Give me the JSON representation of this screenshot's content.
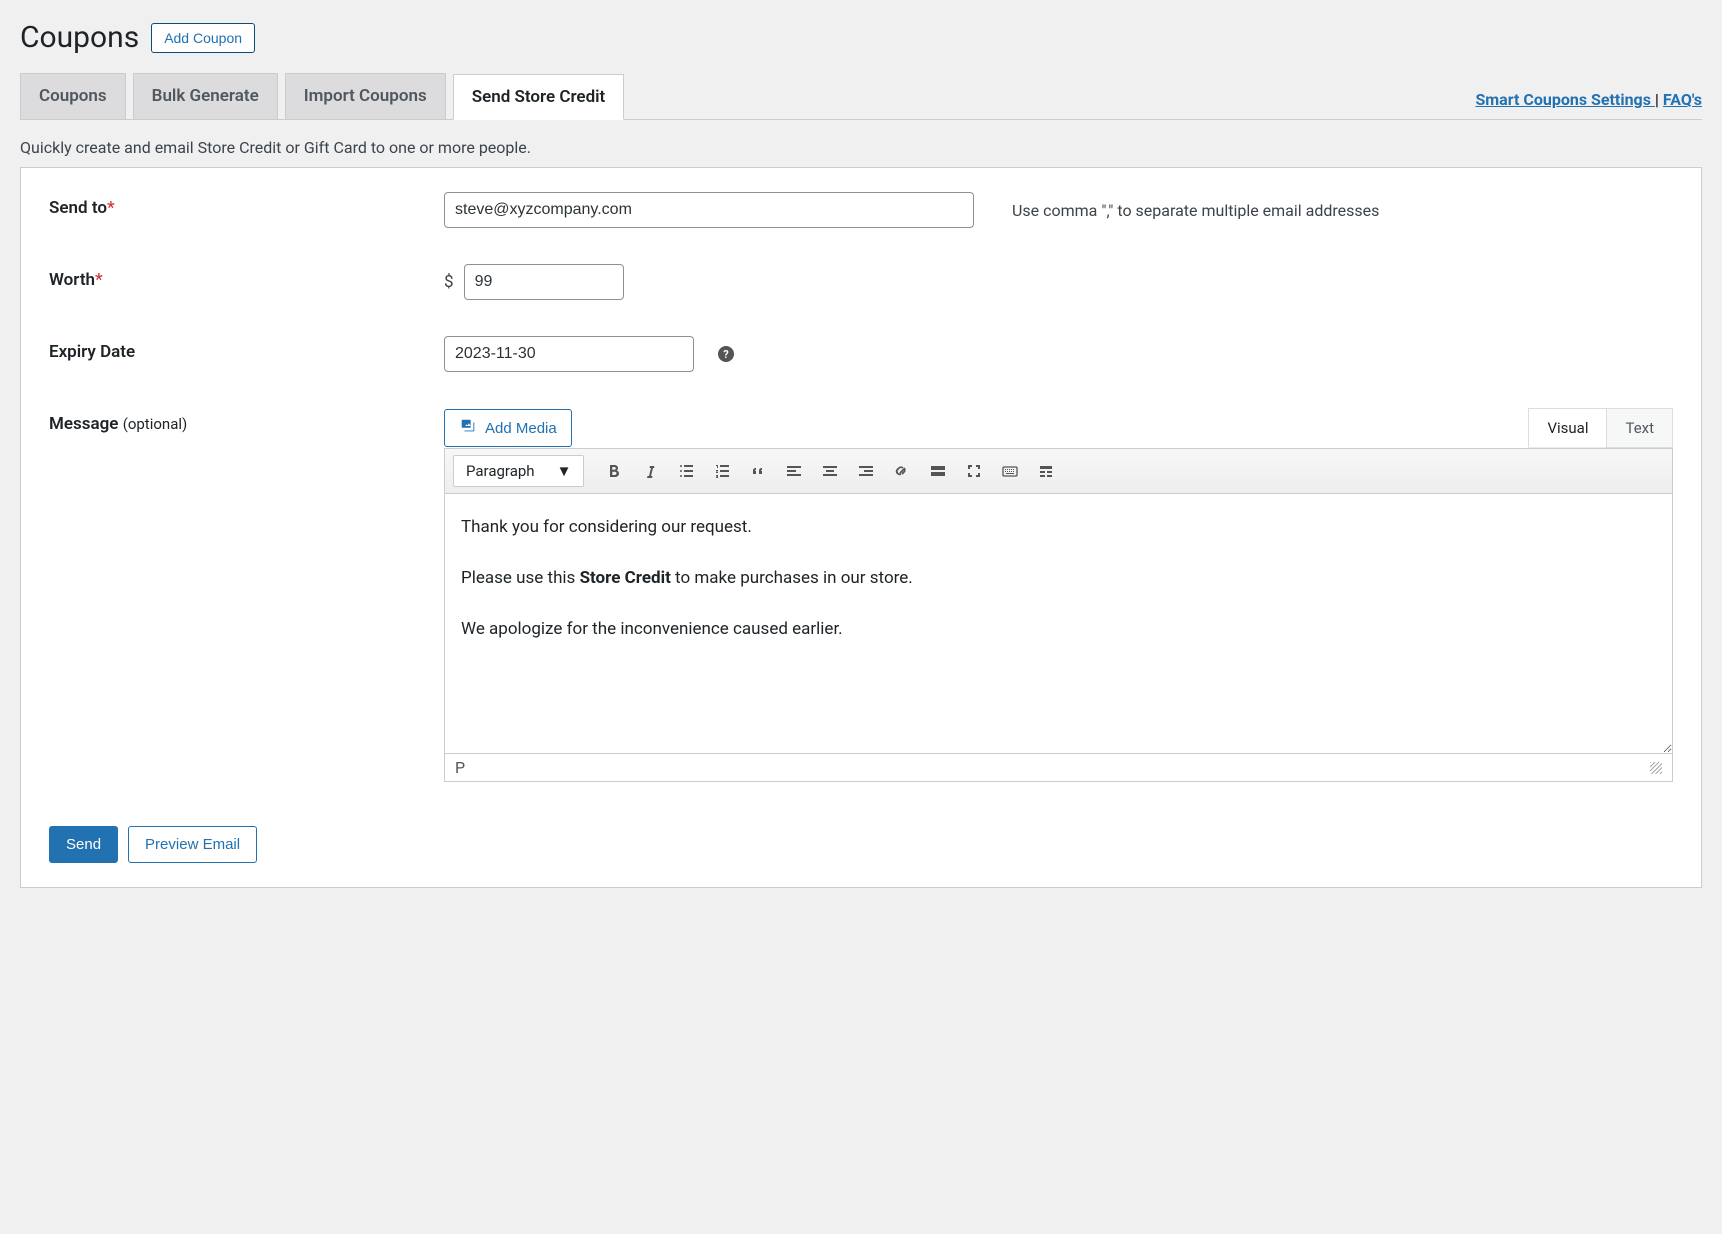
{
  "header": {
    "title": "Coupons",
    "add_button": "Add Coupon"
  },
  "tabs": {
    "items": [
      {
        "label": "Coupons"
      },
      {
        "label": "Bulk Generate"
      },
      {
        "label": "Import Coupons"
      },
      {
        "label": "Send Store Credit"
      }
    ],
    "right_links": {
      "settings": "Smart Coupons Settings ",
      "separator": "| ",
      "faqs": "FAQ's"
    }
  },
  "subtitle": "Quickly create and email Store Credit or Gift Card to one or more people.",
  "form": {
    "send_to": {
      "label": "Send to",
      "value": "steve@xyzcompany.com",
      "hint": "Use comma \",\" to separate multiple email addresses"
    },
    "worth": {
      "label": "Worth",
      "currency": "$",
      "value": "99"
    },
    "expiry": {
      "label": "Expiry Date",
      "value": "2023-11-30",
      "help": "?"
    },
    "message": {
      "label": "Message ",
      "optional_text": "(optional)",
      "add_media": "Add Media",
      "mode_tabs": {
        "visual": "Visual",
        "text": "Text"
      },
      "format_select": "Paragraph",
      "body": {
        "p1": "Thank you for considering our request.",
        "p2_pre": "Please use this ",
        "p2_bold": "Store Credit",
        "p2_post": " to make purchases in our store.",
        "p3": "We apologize for the inconvenience caused earlier."
      },
      "status_path": "P"
    }
  },
  "actions": {
    "send": "Send",
    "preview": "Preview Email"
  }
}
